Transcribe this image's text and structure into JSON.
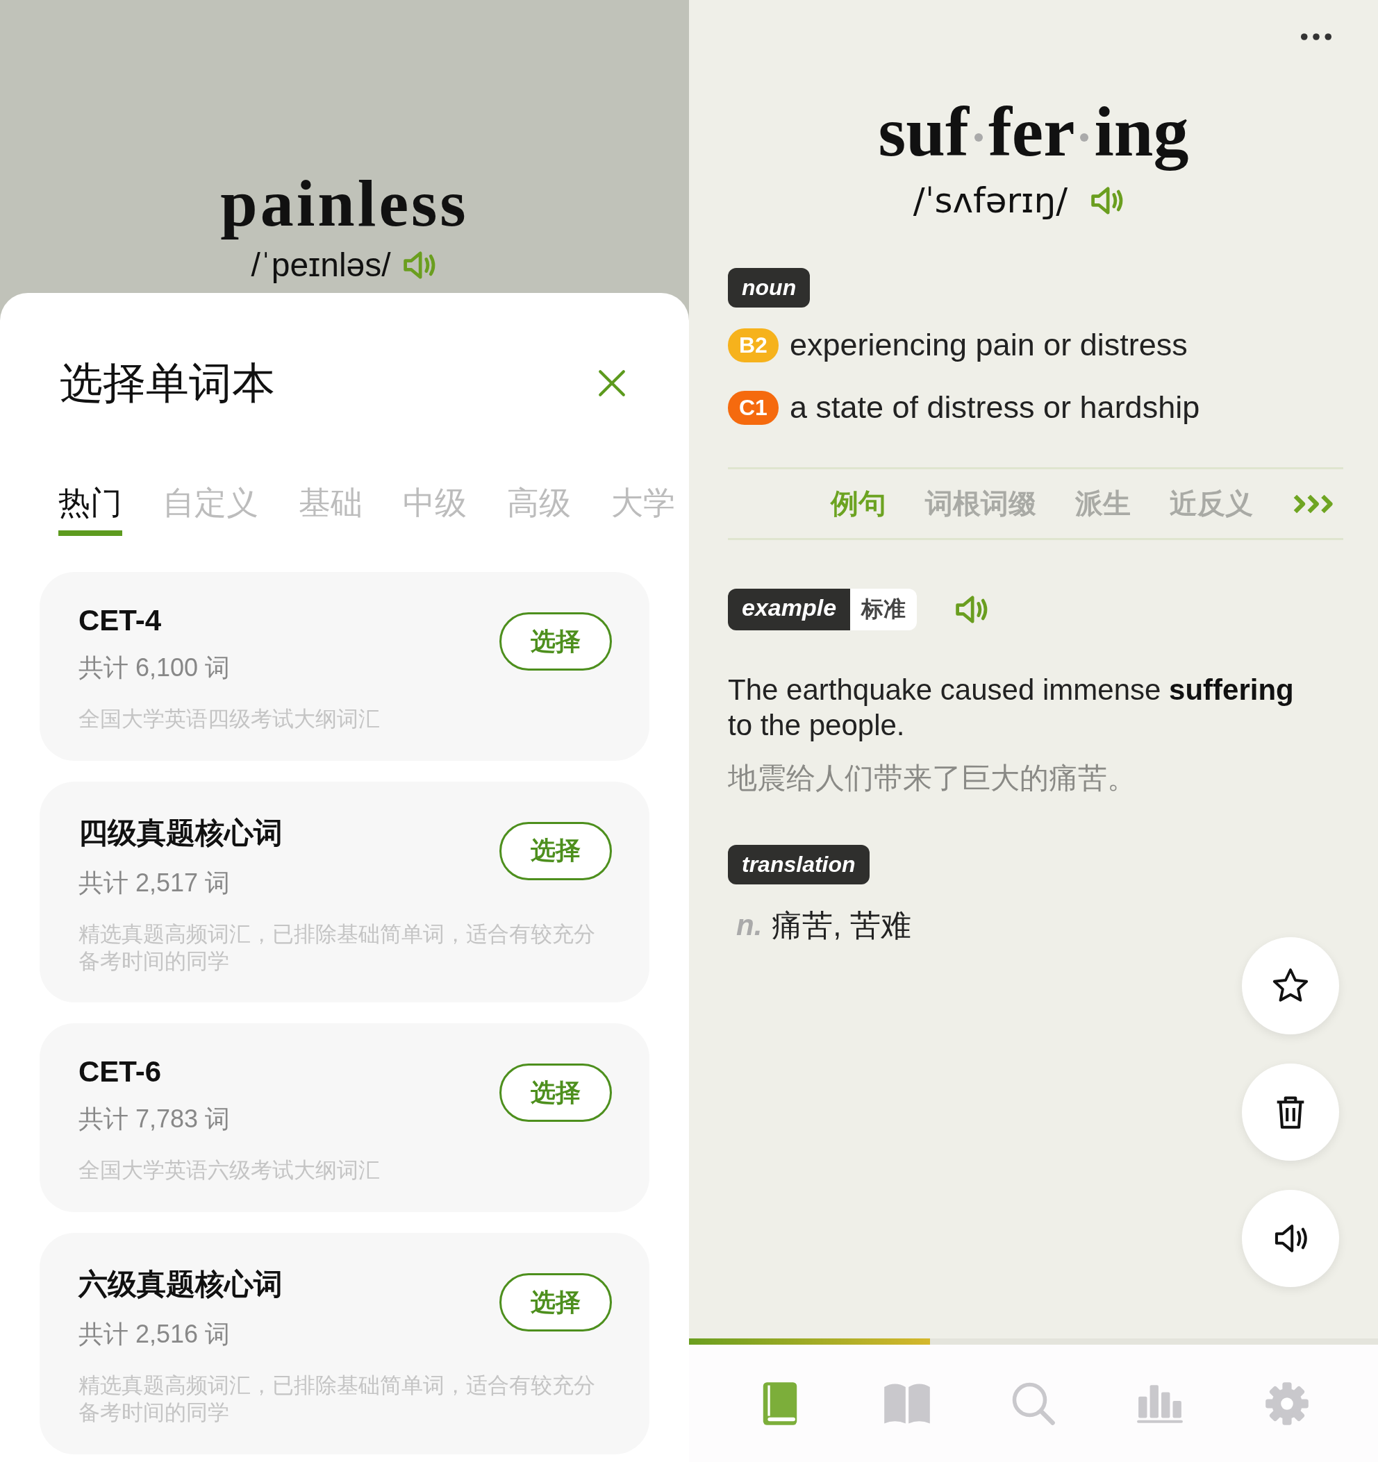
{
  "background_word": {
    "word": "painless",
    "phonetic": "/ˈpeɪnləs/"
  },
  "sheet": {
    "title": "选择单词本",
    "tabs": [
      {
        "label": "热门",
        "selected": true
      },
      {
        "label": "自定义",
        "selected": false
      },
      {
        "label": "基础",
        "selected": false
      },
      {
        "label": "中级",
        "selected": false
      },
      {
        "label": "高级",
        "selected": false
      },
      {
        "label": "大学",
        "selected": false
      }
    ],
    "books": [
      {
        "name": "CET-4",
        "count": "共计 6,100 词",
        "description": "全国大学英语四级考试大纲词汇",
        "button": "选择"
      },
      {
        "name": "四级真题核心词",
        "count": "共计 2,517 词",
        "description": "精选真题高频词汇，已排除基础简单词，适合有较充分备考时间的同学",
        "button": "选择"
      },
      {
        "name": "CET-6",
        "count": "共计 7,783 词",
        "description": "全国大学英语六级考试大纲词汇",
        "button": "选择"
      },
      {
        "name": "六级真题核心词",
        "count": "共计 2,516 词",
        "description": "精选真题高频词汇，已排除基础简单词，适合有较充分备考时间的同学",
        "button": "选择"
      }
    ]
  },
  "word": {
    "syllables": [
      "suf",
      "fer",
      "ing"
    ],
    "phonetic": "/ˈsʌfərɪŋ/",
    "part_of_speech": "noun",
    "definitions": [
      {
        "level": "B2",
        "color": "#f6b21c",
        "text": "experiencing pain or distress"
      },
      {
        "level": "C1",
        "color": "#f56a0e",
        "text": "a state of distress or hardship"
      }
    ]
  },
  "detail_tabs": [
    {
      "label": "例句",
      "selected": true
    },
    {
      "label": "词根词缀",
      "selected": false
    },
    {
      "label": "派生",
      "selected": false
    },
    {
      "label": "近反义",
      "selected": false
    }
  ],
  "example": {
    "tag": "example",
    "accent": "标准",
    "sentence": "The earthquake caused immense **suffering** to the people.",
    "translation": "地震给人们带来了巨大的痛苦。"
  },
  "translation": {
    "tag": "translation",
    "part_of_speech": "n.",
    "text": "痛苦, 苦难"
  },
  "progress": {
    "level": 0.35
  },
  "nav": [
    {
      "kind": "book",
      "selected": true
    },
    {
      "kind": "open-book",
      "selected": false
    },
    {
      "kind": "search",
      "selected": false
    },
    {
      "kind": "chart",
      "selected": false
    },
    {
      "kind": "settings",
      "selected": false
    }
  ]
}
